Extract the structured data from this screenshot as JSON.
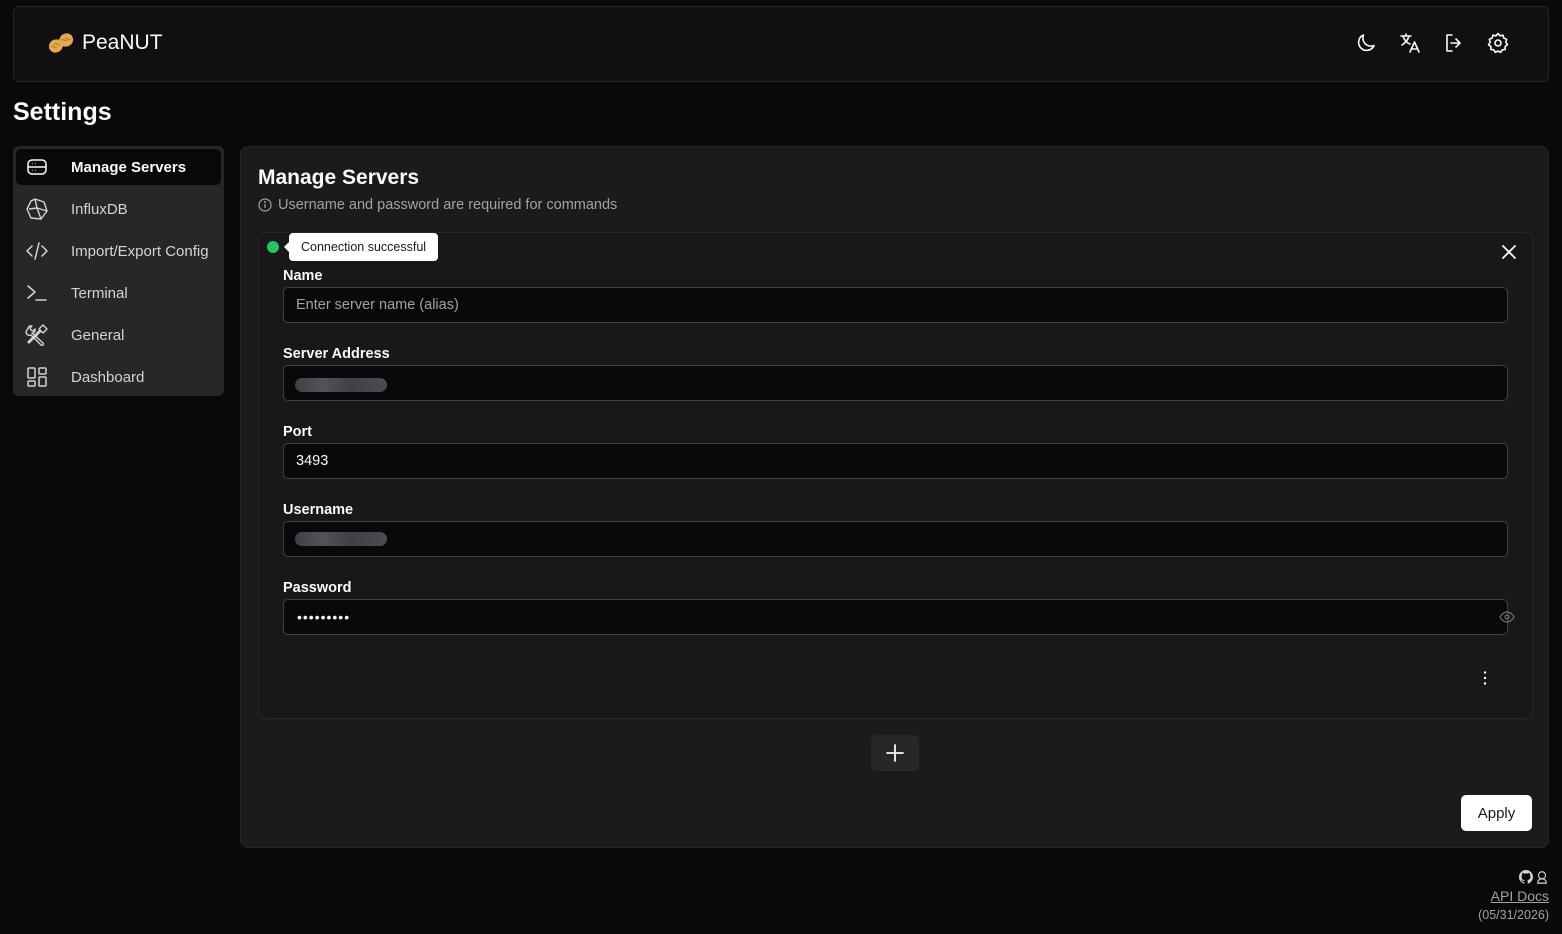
{
  "header": {
    "app_name": "PeaNUT",
    "icons": [
      "peanut-logo-icon",
      "moon-icon",
      "translate-icon",
      "logout-icon",
      "gear-icon"
    ]
  },
  "page": {
    "title": "Settings"
  },
  "sidebar": {
    "items": [
      {
        "label": "Manage Servers",
        "icon": "server-icon",
        "active": true
      },
      {
        "label": "InfluxDB",
        "icon": "influxdb-icon",
        "active": false
      },
      {
        "label": "Import/Export Config",
        "icon": "code-icon",
        "active": false
      },
      {
        "label": "Terminal",
        "icon": "terminal-icon",
        "active": false
      },
      {
        "label": "General",
        "icon": "tools-icon",
        "active": false
      },
      {
        "label": "Dashboard",
        "icon": "dashboard-icon",
        "active": false
      }
    ]
  },
  "main": {
    "title": "Manage Servers",
    "hint": "Username and password are required for commands",
    "server": {
      "status_tooltip": "Connection successful",
      "status_color": "#22c55e",
      "fields": {
        "name": {
          "label": "Name",
          "value": "",
          "placeholder": "Enter server name (alias)"
        },
        "address": {
          "label": "Server Address"
        },
        "port": {
          "label": "Port",
          "value": "3493"
        },
        "username": {
          "label": "Username"
        },
        "password": {
          "label": "Password",
          "masked": "•••••••••"
        }
      }
    },
    "apply_label": "Apply"
  },
  "footer": {
    "api_docs": "API Docs",
    "date": "(05/31/2026)"
  }
}
